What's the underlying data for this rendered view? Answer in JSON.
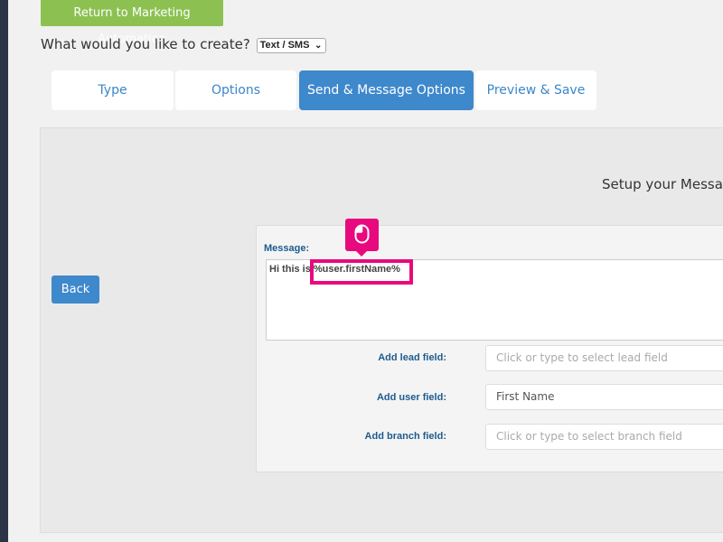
{
  "header": {
    "return_label": "Return to Marketing Automation",
    "create_prompt": "What would you like to create?",
    "create_type": "Text / SMS"
  },
  "tabs": [
    {
      "label": "Type",
      "active": false
    },
    {
      "label": "Options",
      "active": false
    },
    {
      "label": "Send & Message Options",
      "active": true
    },
    {
      "label": "Preview & Save",
      "active": false
    }
  ],
  "panel": {
    "title": "Setup your Messag",
    "back_label": "Back"
  },
  "form": {
    "message_label": "Message:",
    "message_prefix": "Hi this is",
    "message_token": "%user.firstName%",
    "lead_field": {
      "label": "Add lead field:",
      "placeholder": "Click or type to select lead field"
    },
    "user_field": {
      "label": "Add user field:",
      "value": "First Name"
    },
    "branch_field": {
      "label": "Add branch field:",
      "placeholder": "Click or type to select branch field"
    }
  },
  "colors": {
    "accent": "#3e88cc",
    "return_button": "#8cc152",
    "highlight": "#e8097e",
    "label": "#1e5b8e"
  },
  "icons": {
    "click_indicator": "mouse-icon",
    "select_chevron": "chevron-down-icon"
  }
}
